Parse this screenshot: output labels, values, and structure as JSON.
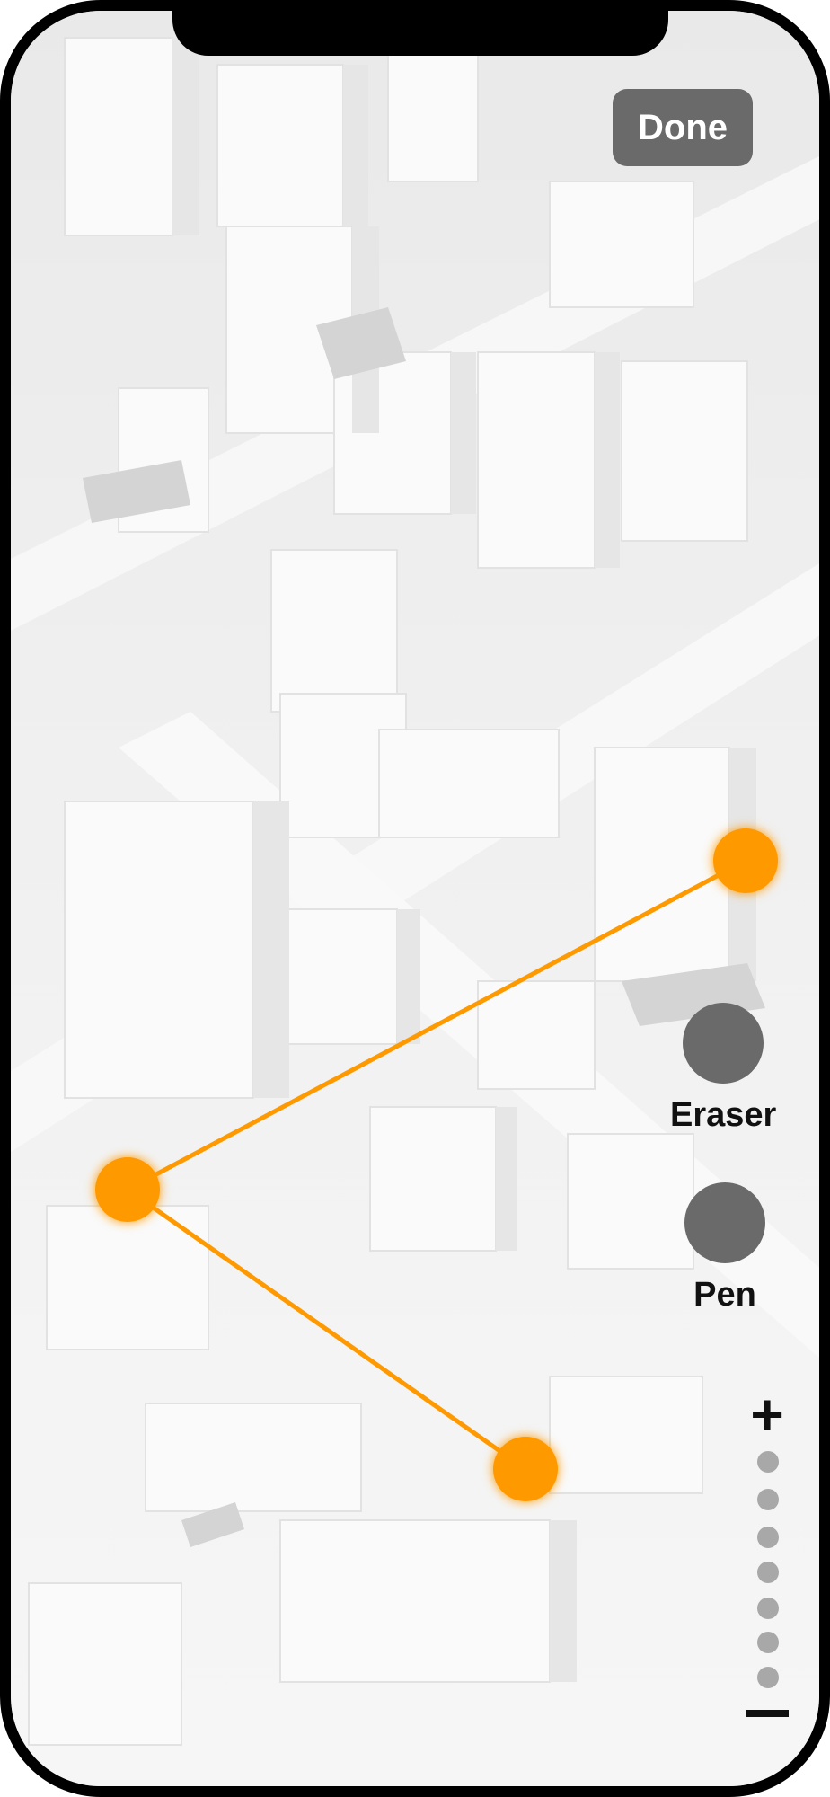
{
  "toolbar": {
    "done_label": "Done"
  },
  "tools": [
    {
      "label": "Eraser",
      "icon": "eraser-circle-icon"
    },
    {
      "label": "Pen",
      "icon": "pen-circle-icon"
    }
  ],
  "zoom": {
    "in_label": "+",
    "level_count": 7,
    "out_icon": "minus-icon"
  },
  "route": {
    "color": "#ff9900",
    "point_count": 3
  },
  "colors": {
    "button_gray": "#6a6a6a",
    "accent": "#ff9900",
    "zoom_dot": "#a8a8a8"
  }
}
